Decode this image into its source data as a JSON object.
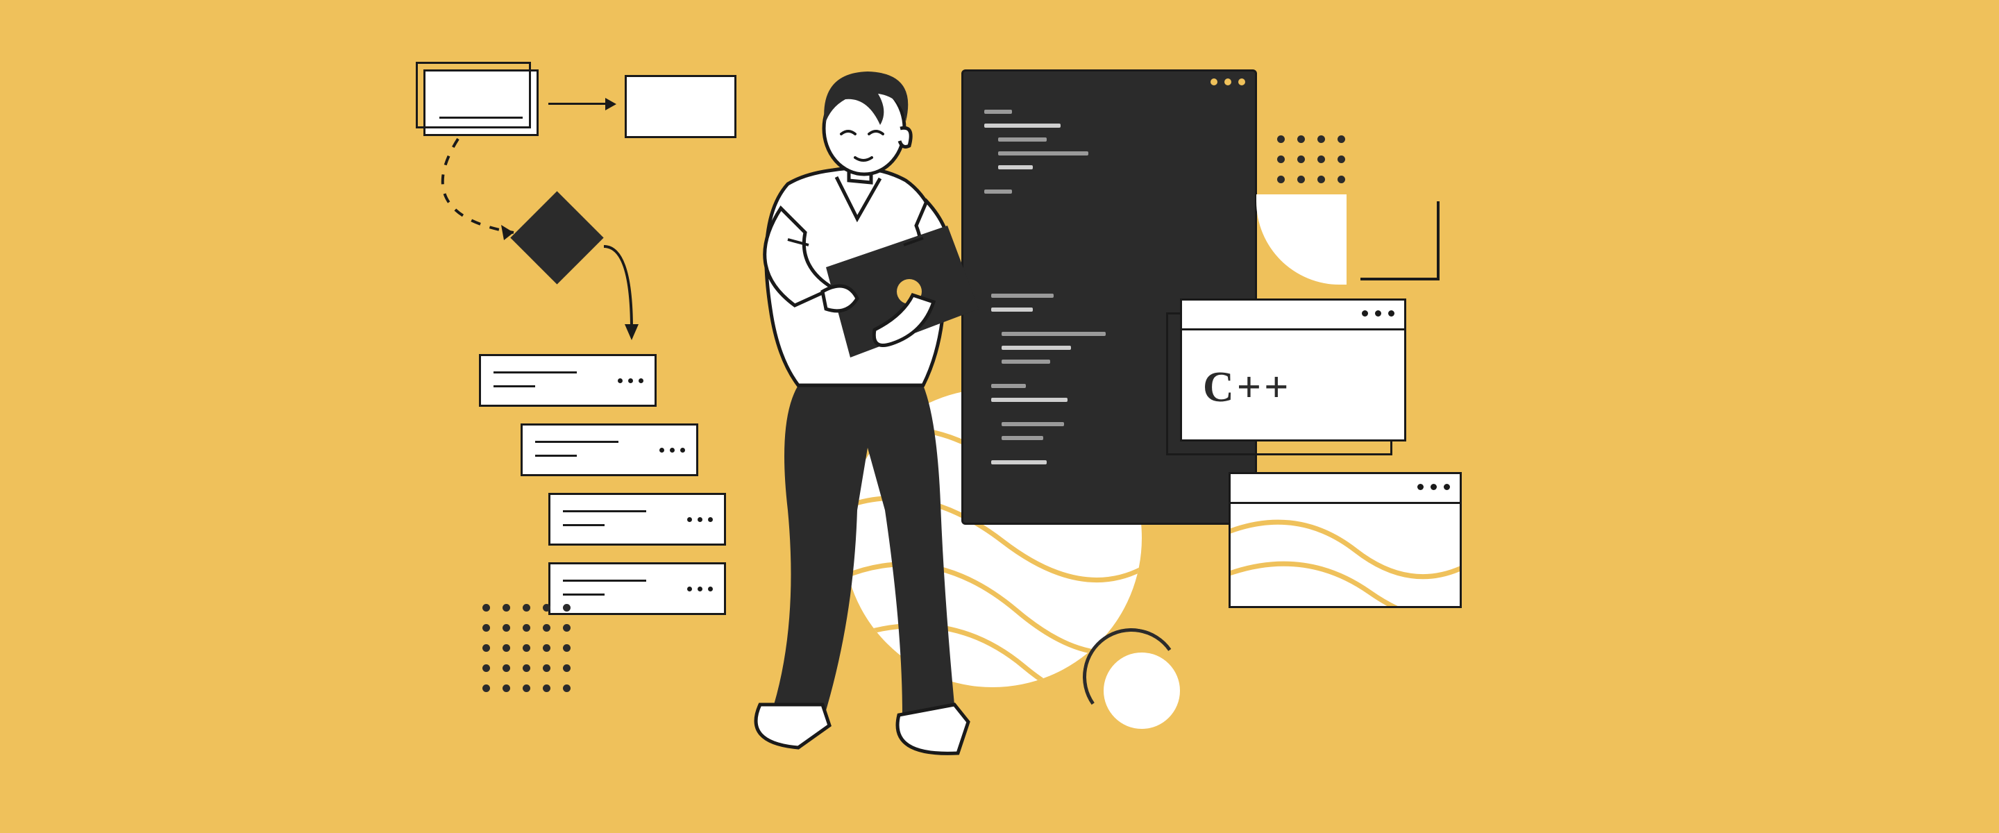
{
  "illustration": {
    "language_label": "C++",
    "colors": {
      "background": "#efc15b",
      "dark": "#2b2b2b",
      "outline": "#1a1a1a",
      "white": "#ffffff"
    }
  }
}
